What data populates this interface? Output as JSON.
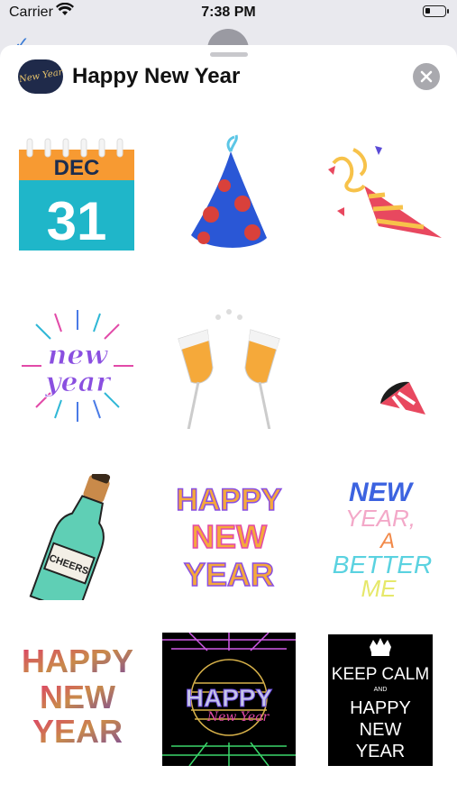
{
  "status_bar": {
    "carrier": "Carrier",
    "time": "7:38 PM"
  },
  "sheet": {
    "title": "Happy New Year",
    "app_icon_text": "New Year"
  },
  "stickers": {
    "calendar": {
      "month": "DEC",
      "day": "31"
    },
    "new_year_burst": {
      "line1": "new",
      "line2": "year"
    },
    "cheers_bottle": {
      "label": "CHEERS"
    },
    "happy_new_year_lettering": {
      "line1": "HAPPY",
      "line2": "NEW",
      "line3": "YEAR"
    },
    "better_me": {
      "line1": "NEW",
      "line2": "YEAR,",
      "line3": "A",
      "line4": "BETTER",
      "line5": "ME"
    },
    "happy_new_year_photo": {
      "line1": "HAPPY",
      "line2": "NEW",
      "line3": "YEAR"
    },
    "retro_happy": {
      "line1": "HAPPY",
      "line2": "New Year"
    },
    "keep_calm": {
      "line1": "KEEP CALM",
      "line2": "AND",
      "line3": "HAPPY",
      "line4": "NEW",
      "line5": "YEAR"
    }
  },
  "colors": {
    "calendar_orange": "#f79a32",
    "calendar_teal": "#1fb6c9",
    "hat_blue": "#2a57d6",
    "hat_red": "#d9413b",
    "horn_pink": "#e8485f",
    "bottle_green": "#5fcfb5"
  }
}
